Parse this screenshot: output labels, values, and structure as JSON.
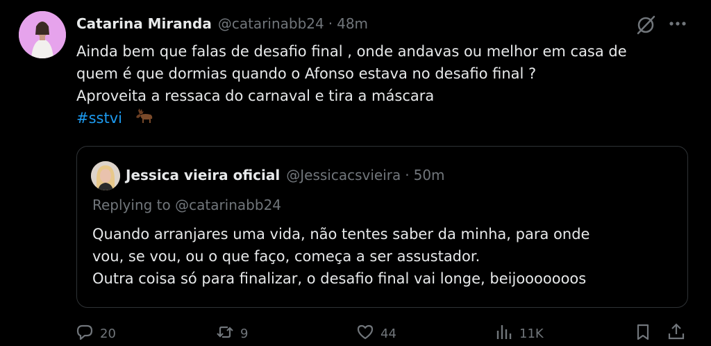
{
  "tweet": {
    "author_name": "Catarina Miranda",
    "author_handle": "@catarinabb24",
    "separator": "·",
    "time": "48m",
    "text_lines": [
      "Ainda bem que falas de desafio final , onde andavas ou melhor em casa de",
      "quem é que dormias quando o Afonso estava no desafio final ?",
      "Aproveita a ressaca do carnaval e tira a máscara"
    ],
    "hashtag": "#sstvi",
    "emoji": "moose-emoji"
  },
  "quote": {
    "author_name": "Jessica vieira oficial",
    "author_handle": "@Jessicacsvieira",
    "separator": "·",
    "time": "50m",
    "replying_to": "Replying to @catarinabb24",
    "text_lines": [
      "Quando arranjares uma vida, não tentes saber da minha, para onde",
      "vou, se vou, ou o que faço, começa a ser assustador.",
      "Outra coisa só para finalizar, o desafio final vai longe, beijooooooos"
    ]
  },
  "actions": {
    "replies": "20",
    "reposts": "9",
    "likes": "44",
    "views": "11K"
  },
  "icons": {
    "grok": "grok-icon",
    "more": "more-icon",
    "reply": "reply-icon",
    "repost": "repost-icon",
    "like": "heart-icon",
    "views": "views-icon",
    "bookmark": "bookmark-icon",
    "share": "share-icon"
  },
  "colors": {
    "background": "#000000",
    "text": "#e7e9ea",
    "secondary": "#71767b",
    "link": "#1d9bf0",
    "border": "#2f3336"
  }
}
